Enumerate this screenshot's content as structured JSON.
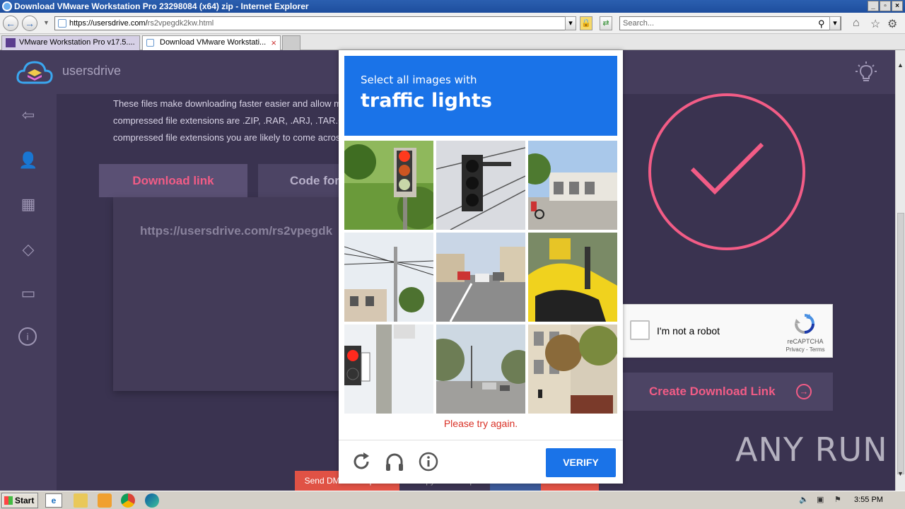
{
  "window": {
    "title": "Download VMware Workstation Pro 23298084 (x64) zip - Internet Explorer",
    "minimize": "_",
    "restore": "▫",
    "close": "×"
  },
  "browser": {
    "url_host": "https://usersdrive.com/",
    "url_path": "rs2vpegdk2kw.html",
    "search_placeholder": "Search...",
    "tabs": [
      {
        "label": "VMware Workstation Pro v17.5....",
        "active": false
      },
      {
        "label": "Download VMware Workstati...",
        "active": true
      }
    ]
  },
  "site": {
    "logo_text": "usersdrive",
    "article_lines": [
      "These files make downloading faster easier and allow m",
      "compressed file extensions are .ZIP, .RAR, .ARJ, .TAR.GZ",
      "compressed file extensions you are likely to come acros"
    ],
    "tab_download_label": "Download link",
    "tab_code_label": "Code for",
    "link_text": "https://usersdrive.com/rs2vpegdk",
    "create_button_label": "Create Download Link",
    "watermark": "ANY RUN",
    "bottom_buttons": [
      {
        "label": "Send DMCA complaint",
        "color": "#e05245"
      },
      {
        "label": "Copy link to clip",
        "color": "#3b3452"
      },
      {
        "label": "Facebook",
        "color": "#3b5998"
      },
      {
        "label": "Twitter",
        "color": "#e05245"
      }
    ],
    "accent_color": "#f25c86"
  },
  "recaptcha": {
    "checkbox_label": "I'm not a robot",
    "brand": "reCAPTCHA",
    "links": "Privacy - Terms"
  },
  "captcha": {
    "intro": "Select all images with",
    "target": "traffic lights",
    "error": "Please try again.",
    "verify_label": "VERIFY",
    "tiles": [
      "traffic-light-closeup",
      "traffic-light-pole",
      "street-corner-cyclist",
      "power-lines-street",
      "busy-intersection",
      "yellow-scooter",
      "pedestrian-signal",
      "tree-lined-road",
      "building-street"
    ],
    "header_color": "#1a73e8"
  },
  "taskbar": {
    "start_label": "Start",
    "time": "3:55 PM"
  }
}
